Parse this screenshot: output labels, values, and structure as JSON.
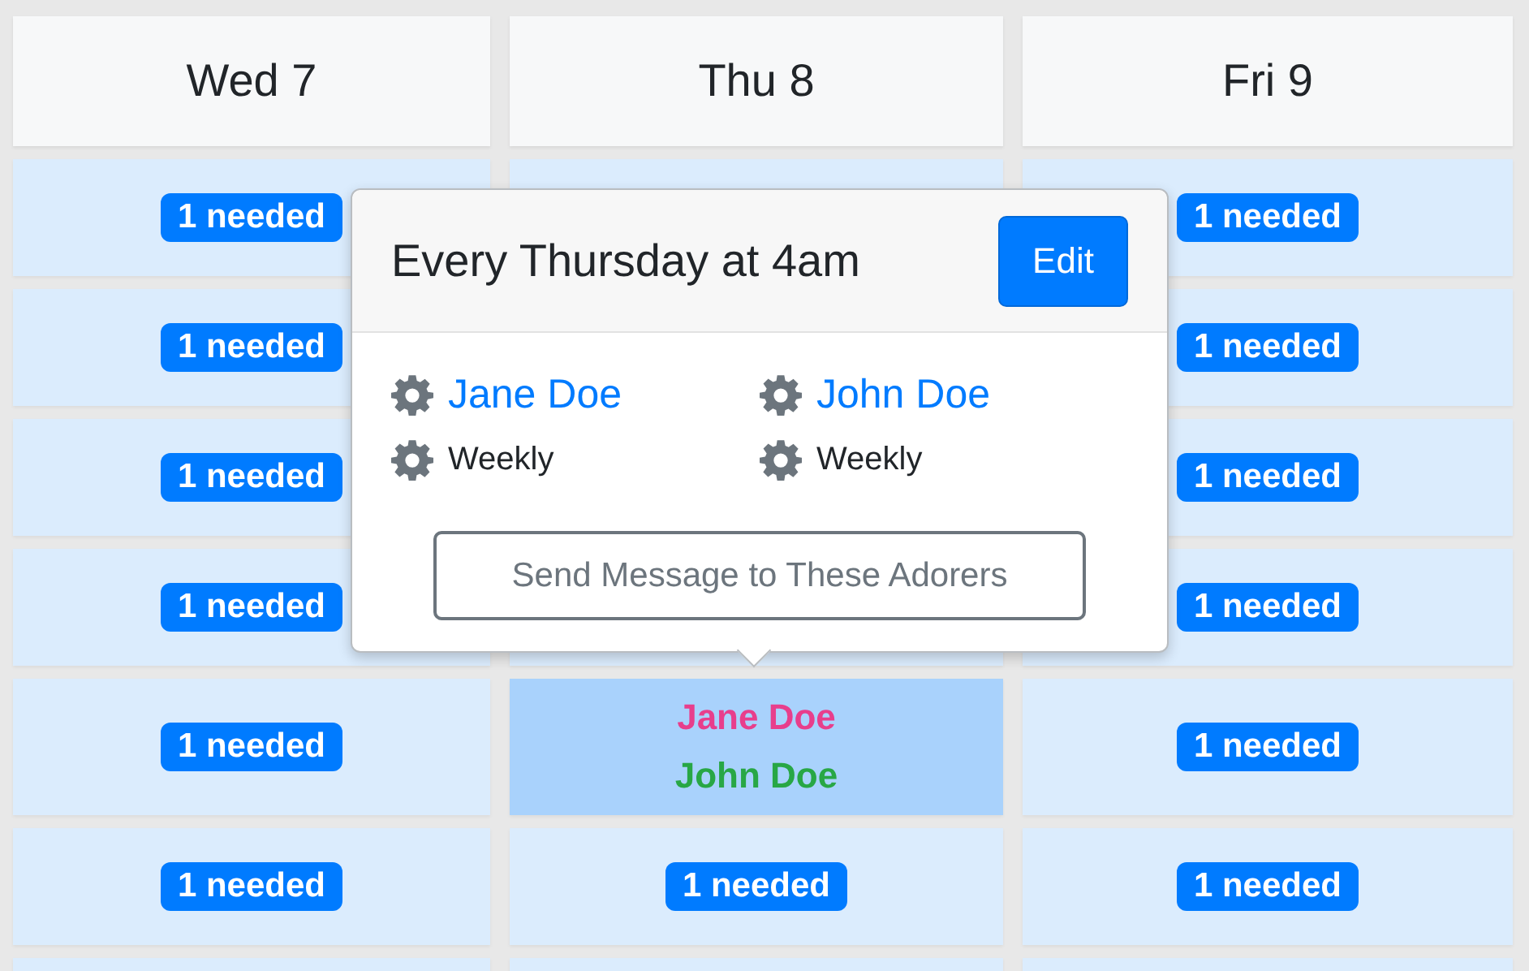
{
  "days": [
    {
      "label": "Wed 7"
    },
    {
      "label": "Thu 8"
    },
    {
      "label": "Fri 9"
    }
  ],
  "rows": [
    {
      "cells": [
        {
          "kind": "needed",
          "text": "1 needed",
          "selected": false
        },
        {
          "kind": "empty",
          "selected": false
        },
        {
          "kind": "needed",
          "text": "1 needed",
          "selected": false
        }
      ]
    },
    {
      "cells": [
        {
          "kind": "needed",
          "text": "1 needed",
          "selected": false
        },
        {
          "kind": "empty"
        },
        {
          "kind": "needed",
          "text": "1 needed",
          "selected": false
        }
      ]
    },
    {
      "cells": [
        {
          "kind": "needed",
          "text": "1 needed",
          "selected": false
        },
        {
          "kind": "empty"
        },
        {
          "kind": "needed",
          "text": "1 needed",
          "selected": false
        }
      ]
    },
    {
      "cells": [
        {
          "kind": "needed",
          "text": "1 needed",
          "selected": false
        },
        {
          "kind": "empty",
          "selected": false
        },
        {
          "kind": "needed",
          "text": "1 needed",
          "selected": false
        }
      ]
    },
    {
      "cells": [
        {
          "kind": "needed",
          "text": "1 needed",
          "selected": false
        },
        {
          "kind": "assigned",
          "selected": true,
          "names": [
            {
              "text": "Jane Doe",
              "color": "#e83e8c"
            },
            {
              "text": "John Doe",
              "color": "#28a745"
            }
          ]
        },
        {
          "kind": "needed",
          "text": "1 needed",
          "selected": false
        }
      ]
    },
    {
      "cells": [
        {
          "kind": "needed",
          "text": "1 needed",
          "selected": false
        },
        {
          "kind": "needed",
          "text": "1 needed",
          "selected": false
        },
        {
          "kind": "needed",
          "text": "1 needed",
          "selected": false
        }
      ]
    },
    {
      "cells": [
        {
          "kind": "empty",
          "selected": false
        },
        {
          "kind": "empty",
          "selected": false
        },
        {
          "kind": "empty",
          "selected": false
        }
      ]
    }
  ],
  "popover": {
    "title": "Every Thursday at 4am",
    "edit_button": "Edit",
    "people": [
      {
        "name": "Jane Doe",
        "frequency": "Weekly"
      },
      {
        "name": "John Doe",
        "frequency": "Weekly"
      }
    ],
    "message_button": "Send Message to These Adorers"
  }
}
